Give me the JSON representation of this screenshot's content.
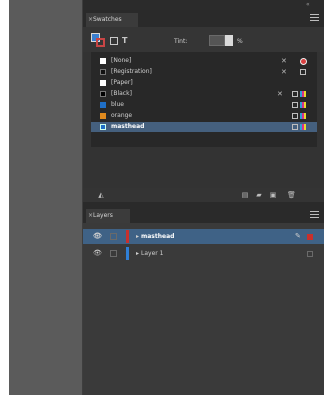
{
  "swatches_panel": {
    "tab_label": "Swatches",
    "tint_label": "Tint:",
    "tint_value": "",
    "tint_unit": "%",
    "items": [
      {
        "label": "[None]",
        "chip_color": "#ffffff",
        "right_icons": [
          "x-icon",
          "registration-icon"
        ]
      },
      {
        "label": "[Registration]",
        "chip_color": "#111111",
        "right_icons": [
          "x-icon",
          "square-icon"
        ]
      },
      {
        "label": "[Paper]",
        "chip_color": "#ffffff",
        "right_icons": []
      },
      {
        "label": "[Black]",
        "chip_color": "#000000",
        "right_icons": [
          "x-icon",
          "square-icon",
          "cmyk-icon"
        ]
      },
      {
        "label": "blue",
        "chip_color": "#1f6fc7",
        "right_icons": [
          "square-icon",
          "cmyk-icon"
        ]
      },
      {
        "label": "orange",
        "chip_color": "#e08a1e",
        "right_icons": [
          "square-icon",
          "cmyk-icon"
        ]
      },
      {
        "label": "masthead",
        "chip_color": "#1f6fc7",
        "right_icons": [
          "square-icon",
          "cmyk-icon"
        ],
        "selected": true
      }
    ]
  },
  "layers_panel": {
    "tab_label": "Layers",
    "items": [
      {
        "label": "masthead",
        "color": "#c8302c",
        "selected": true
      },
      {
        "label": "Layer 1",
        "color": "#2f7fd6",
        "selected": false
      }
    ]
  },
  "colors": {
    "accent_selection": "#45607e",
    "layer_selection": "#3f6286"
  }
}
